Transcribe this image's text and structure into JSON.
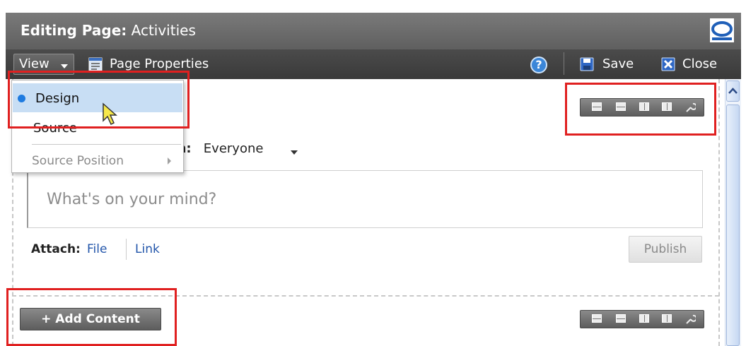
{
  "window": {
    "title_prefix": "Editing Page:",
    "title_page": "Activities"
  },
  "toolbar": {
    "view_label": "View",
    "page_properties_label": "Page Properties",
    "help_label": "?",
    "save_label": "Save",
    "close_label": "Close"
  },
  "view_menu": {
    "items": [
      {
        "label": "Design",
        "selected": true
      },
      {
        "label": "Source",
        "selected": false
      },
      {
        "label": "Source Position",
        "has_submenu": true,
        "disabled": true
      }
    ]
  },
  "share": {
    "label_partial": "th:",
    "audience": "Everyone"
  },
  "status": {
    "placeholder": "What's on your mind?"
  },
  "attach": {
    "label": "Attach:",
    "file": "File",
    "link": "Link"
  },
  "publish_label": "Publish",
  "add_content_label": "+ Add Content",
  "icons": {
    "logo": "oracle-logo-icon",
    "page_properties": "page-properties-icon",
    "help": "help-icon",
    "save": "save-icon",
    "close": "close-icon",
    "layout": [
      "layout-one-column-icon",
      "layout-two-rows-icon",
      "layout-three-columns-icon",
      "layout-two-columns-icon",
      "wrench-icon"
    ]
  },
  "colors": {
    "title_bar": "#6b6b6b",
    "toolbar": "#434343",
    "menu_selected": "#c8def4",
    "annotation": "#e02020",
    "link": "#2255aa"
  }
}
